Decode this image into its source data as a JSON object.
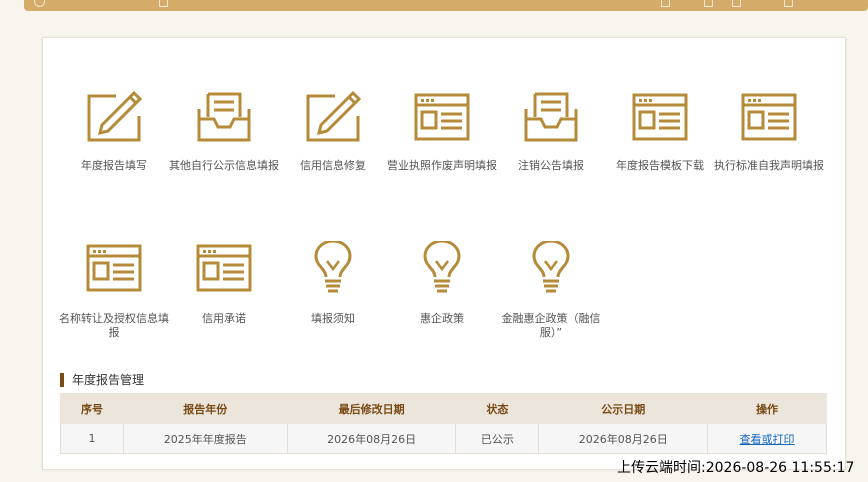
{
  "functions": [
    {
      "label": "年度报告填写",
      "icon": "pencil-paper-icon"
    },
    {
      "label": "其他自行公示信息填报",
      "icon": "inbox-tray-icon"
    },
    {
      "label": "信用信息修复",
      "icon": "pencil-paper-icon"
    },
    {
      "label": "营业执照作废声明填报",
      "icon": "document-window-icon"
    },
    {
      "label": "注销公告填报",
      "icon": "inbox-tray-icon"
    },
    {
      "label": "年度报告模板下载",
      "icon": "document-window-icon"
    },
    {
      "label": "执行标准自我声明填报",
      "icon": "document-window-icon"
    },
    {
      "label": "名称转让及授权信息填报",
      "icon": "document-window-icon"
    },
    {
      "label": "信用承诺",
      "icon": "document-window-icon"
    },
    {
      "label": "填报须知",
      "icon": "lightbulb-icon"
    },
    {
      "label": "惠企政策",
      "icon": "lightbulb-icon"
    },
    {
      "label": "金融惠企政策（融信服）”",
      "icon": "lightbulb-icon"
    }
  ],
  "annual_report": {
    "title": "年度报告管理",
    "headers": [
      "序号",
      "报告年份",
      "最后修改日期",
      "状态",
      "公示日期",
      "操作"
    ],
    "rows": [
      {
        "no": "1",
        "year": "2025年年度报告",
        "modified": "2026年08月26日",
        "status": "已公示",
        "publish": "2026年08月26日",
        "action": "查看或打印"
      }
    ]
  },
  "upload_time": "上传云端时间:2026-08-26 11:55:17",
  "colors": {
    "accent": "#b58b3a",
    "topbar": "#d4ab68",
    "header_text": "#7a4a14",
    "link": "#1565c0"
  }
}
